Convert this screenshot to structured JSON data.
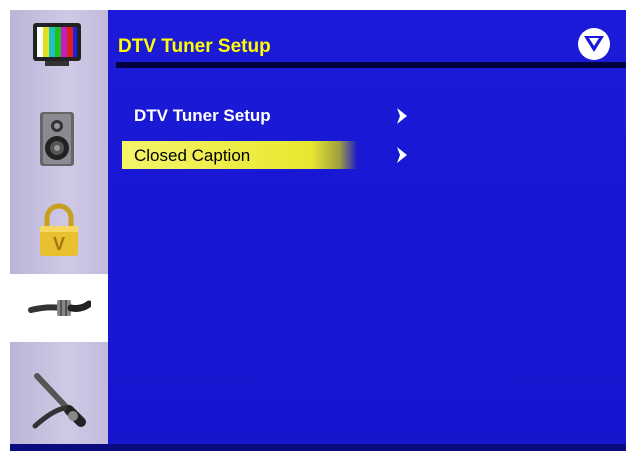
{
  "header": {
    "title": "DTV Tuner Setup"
  },
  "logo": {
    "icon": "vizio-v-logo-icon"
  },
  "sidebar": {
    "items": [
      {
        "name": "picture-icon",
        "active": false
      },
      {
        "name": "audio-speaker-icon",
        "active": false
      },
      {
        "name": "parental-lock-icon",
        "active": false
      },
      {
        "name": "tv-coax-cable-icon",
        "active": true
      },
      {
        "name": "setup-tools-icon",
        "active": false
      }
    ]
  },
  "menu": {
    "items": [
      {
        "label": "DTV Tuner Setup",
        "selected": false
      },
      {
        "label": "Closed Caption",
        "selected": true
      }
    ]
  },
  "colors": {
    "background": "#1818d8",
    "title": "#ffff00",
    "highlight": "#f4f46a",
    "sidebar": "#cfc9e5"
  }
}
